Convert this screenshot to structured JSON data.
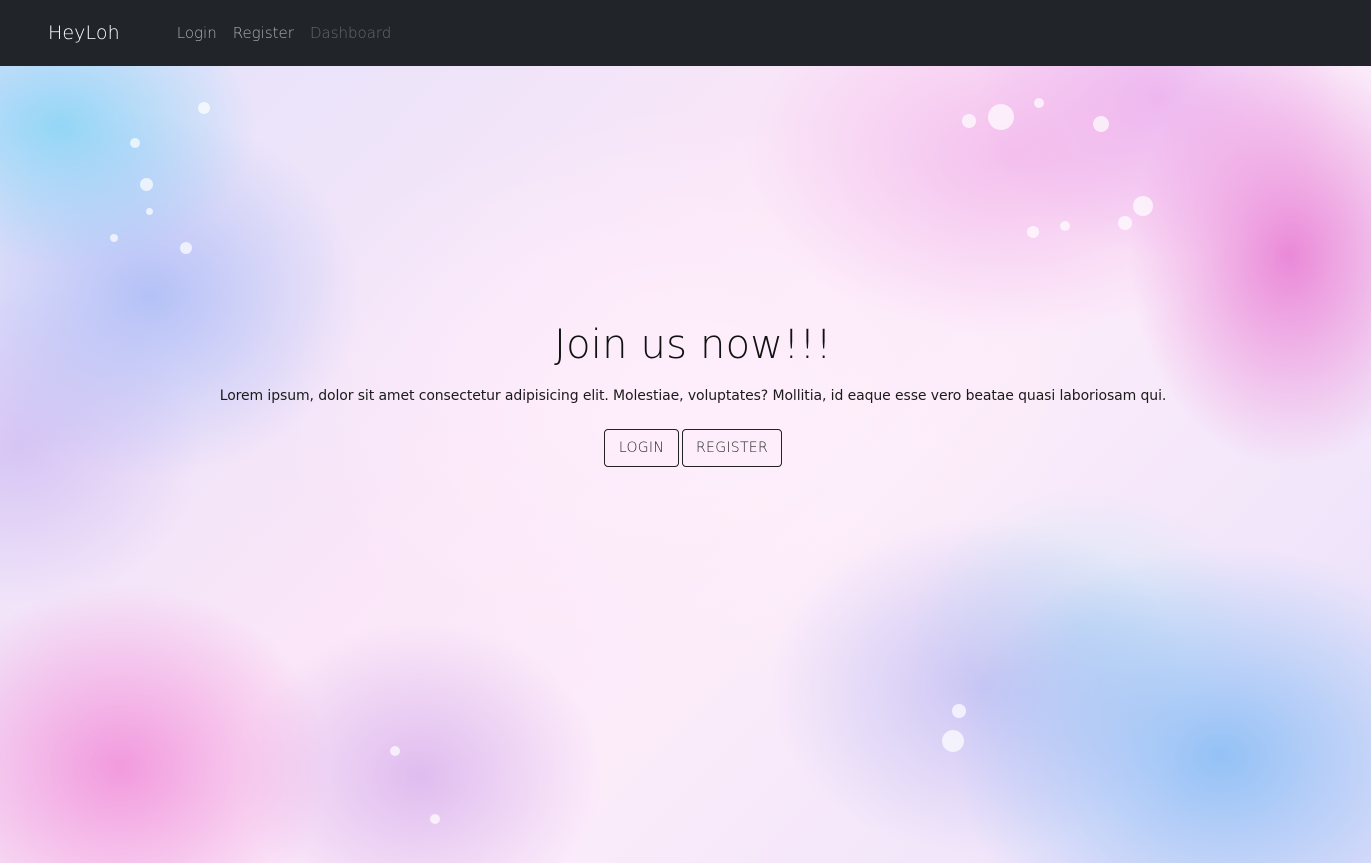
{
  "navbar": {
    "brand": "HeyLoh",
    "links": [
      {
        "label": "Login",
        "state": "active"
      },
      {
        "label": "Register",
        "state": "active"
      },
      {
        "label": "Dashboard",
        "state": "disabled"
      }
    ]
  },
  "hero": {
    "title": "Join us now!!!",
    "text": "Lorem ipsum, dolor sit amet consectetur adipisicing elit. Molestiae, voluptates? Mollitia, id eaque esse vero beatae quasi laboriosam qui.",
    "buttons": {
      "login": "LOGIN",
      "register": "REGISTER"
    }
  },
  "colors": {
    "navbar_bg": "#212529",
    "brand_text": "#ffffff",
    "nav_link": "rgba(255,255,255,0.62)",
    "nav_link_disabled": "rgba(255,255,255,0.30)",
    "hero_text": "#111111",
    "button_border": "#222222"
  }
}
